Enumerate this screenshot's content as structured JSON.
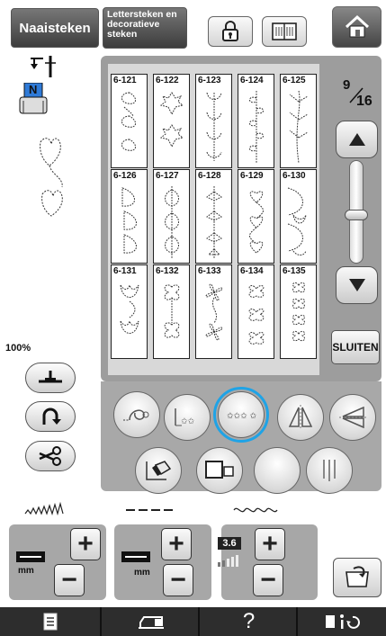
{
  "header": {
    "tab_utility": "Naaisteken",
    "tab_letters": "Lettersteken en decoratieve steken",
    "lock_icon": "lock-icon",
    "manual_icon": "book-icon",
    "home_icon": "home-icon"
  },
  "left_panel": {
    "presser_foot_letter": "N",
    "zoom": "100%"
  },
  "patterns": [
    {
      "id": "6-121",
      "motif": "leaf"
    },
    {
      "id": "6-122",
      "motif": "maple"
    },
    {
      "id": "6-123",
      "motif": "tulip"
    },
    {
      "id": "6-124",
      "motif": "vine"
    },
    {
      "id": "6-125",
      "motif": "branch"
    },
    {
      "id": "6-126",
      "motif": "feather"
    },
    {
      "id": "6-127",
      "motif": "leafstem"
    },
    {
      "id": "6-128",
      "motif": "fern"
    },
    {
      "id": "6-129",
      "motif": "heart"
    },
    {
      "id": "6-130",
      "motif": "tulipcurve"
    },
    {
      "id": "6-131",
      "motif": "bigtulip"
    },
    {
      "id": "6-132",
      "motif": "flower"
    },
    {
      "id": "6-133",
      "motif": "pinwheel"
    },
    {
      "id": "6-134",
      "motif": "clover"
    },
    {
      "id": "6-135",
      "motif": "smallclover"
    }
  ],
  "paging": {
    "current": "9",
    "total": "16",
    "close_label": "SLUITEN"
  },
  "function_buttons": [
    "single-pattern-icon",
    "char-spacing-icon",
    "stars-pattern-icon",
    "mirror-vertical-icon",
    "mirror-horizontal-icon",
    "eraser-icon",
    "pattern-size-icon",
    "blank-icon",
    "twin-needle-icon"
  ],
  "selected_function": "stars-pattern-icon",
  "adjustments": {
    "width_unit": "mm",
    "length_unit": "mm",
    "tension_value": "3.6"
  },
  "footer": {
    "icons": [
      "list-icon",
      "sewing-machine-icon",
      "help-icon",
      "settings-info-icon"
    ],
    "help_label": "?"
  }
}
